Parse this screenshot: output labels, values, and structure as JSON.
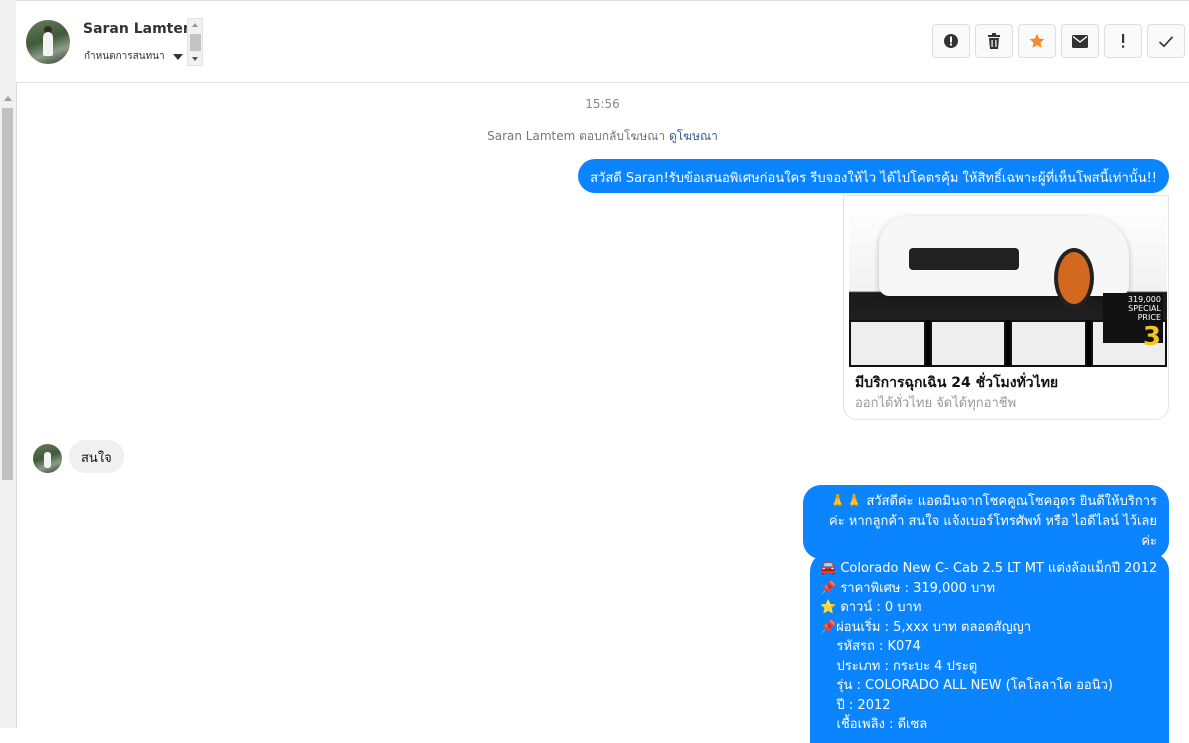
{
  "header": {
    "contact_name": "Saran Lamtem",
    "status_label": "กำหนดการสนทนา"
  },
  "toolbar": {
    "buttons": [
      {
        "name": "alert-icon",
        "glyph": "●"
      },
      {
        "name": "trash-icon",
        "glyph": "🗑"
      },
      {
        "name": "star-icon",
        "glyph": "★"
      },
      {
        "name": "mail-icon",
        "glyph": "✉"
      },
      {
        "name": "exclamation-icon",
        "glyph": "!"
      },
      {
        "name": "check-icon",
        "glyph": "✓"
      }
    ]
  },
  "chat": {
    "timestamp": "15:56",
    "ad_note_prefix": "Saran Lamtem ตอบกลับโฆษณา",
    "ad_note_link": "ดูโฆษณา",
    "messages": {
      "out_1": "สวัสดี Saran!รับข้อเสนอพิเศษก่อนใคร รีบจองให้ไว ได้ไปโคตรคุ้ม ให้สิทธิ์เฉพาะผู้ที่เห็นโพสนี้เท่านั้น!!",
      "in_1": "สนใจ",
      "out_2": "🙏🙏 สวัสดีค่ะ แอดมินจากโชคคูณโชคอุดร ยินดีให้บริการค่ะ หากลูกค้า สนใจ แจ้งเบอร์โทรศัพท์ หรือ ไอดีไลน์  ไว้เลยค่ะ",
      "out_3_lines": [
        "🚘 Colorado New C- Cab 2.5 LT MT แต่งล้อแม็กปี 2012",
        "📌 ราคาพิเศษ : 319,000 บาท",
        "⭐ ดาวน์ : 0 บาท",
        "📌ผ่อนเริ่ม : 5,xxx บาท ตลอดสัญญา",
        "    รหัสรถ : K074",
        "    ประเภท : กระบะ 4 ประตู",
        "    รุ่น : COLORADO ALL NEW (โคโลลาโด ออนิว)",
        "    ปี : 2012",
        "    เชื้อเพลิง : ดีเซล"
      ]
    },
    "ad_card": {
      "title": "มีบริการฉุกเฉิน 24 ชั่วโมงทั่วไทย",
      "subtitle": "ออกได้ทั่วไทย จัดได้ทุกอาชีพ",
      "image_price": "319,000",
      "image_price_label": "SPECIAL PRICE",
      "image_big_number": "3"
    }
  },
  "colors": {
    "outgoing_bubble": "#0a84ff",
    "incoming_bubble": "#f0f0f0",
    "star": "#f28c28"
  }
}
